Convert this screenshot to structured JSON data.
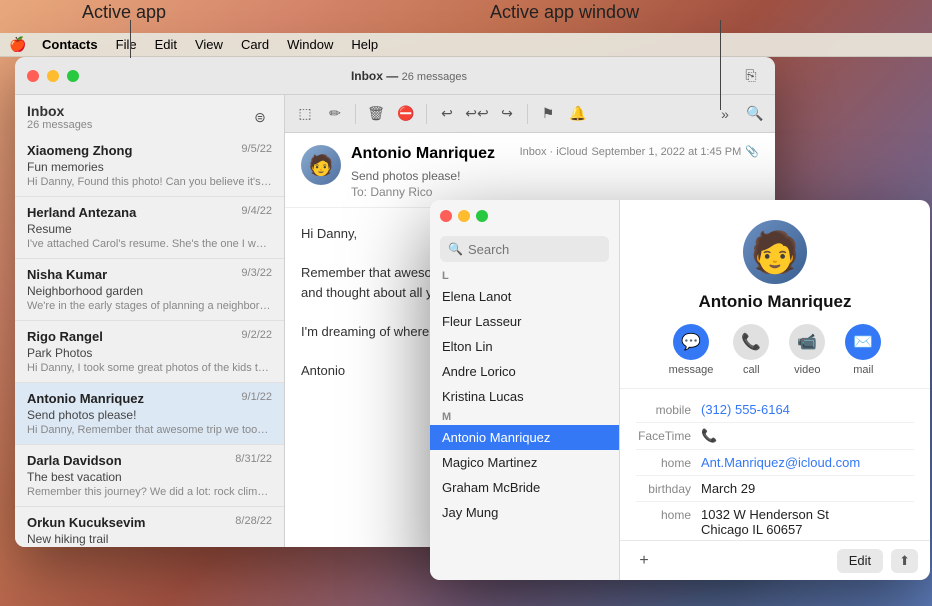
{
  "annotations": {
    "active_app_label": "Active app",
    "active_app_window_label": "Active app window"
  },
  "menubar": {
    "apple_icon": "🍎",
    "items": [
      {
        "label": "Contacts",
        "active": true
      },
      {
        "label": "File"
      },
      {
        "label": "Edit"
      },
      {
        "label": "View"
      },
      {
        "label": "Card"
      },
      {
        "label": "Window"
      },
      {
        "label": "Help"
      }
    ]
  },
  "mail_window": {
    "title": "Inbox",
    "subtitle": "26 messages",
    "messages": [
      {
        "sender": "Xiaomeng Zhong",
        "date": "9/5/22",
        "subject": "Fun memories",
        "preview": "Hi Danny, Found this photo! Can you believe it's been years? Let's start planning our next adventure (or at least...",
        "attachment": true,
        "selected": false
      },
      {
        "sender": "Herland Antezana",
        "date": "9/4/22",
        "subject": "Resume",
        "preview": "I've attached Carol's resume. She's the one I was telling you about. She may not have quite as much experience as you...",
        "attachment": true,
        "selected": false
      },
      {
        "sender": "Nisha Kumar",
        "date": "9/3/22",
        "subject": "Neighborhood garden",
        "preview": "We're in the early stages of planning a neighborhood garden. Each family would be in charge of a plot. Bring yo...",
        "attachment": false,
        "selected": false
      },
      {
        "sender": "Rigo Rangel",
        "date": "9/2/22",
        "subject": "Park Photos",
        "preview": "Hi Danny, I took some great photos of the kids the other day. Check out that smile!",
        "attachment": true,
        "selected": false
      },
      {
        "sender": "Antonio Manriquez",
        "date": "9/1/22",
        "subject": "Send photos please!",
        "preview": "Hi Danny, Remember that awesome trip we took a few years ago? I found this picture, and thought about all your fun r...",
        "attachment": false,
        "selected": true
      },
      {
        "sender": "Darla Davidson",
        "date": "8/31/22",
        "subject": "The best vacation",
        "preview": "Remember this journey? We did a lot: rock climbing, cycling, hiking, and more. This vacation was amazing. An...",
        "attachment": true,
        "selected": false
      },
      {
        "sender": "Orkun Kucuksevim",
        "date": "8/28/22",
        "subject": "New hiking trail",
        "preview": "",
        "attachment": true,
        "selected": false
      }
    ],
    "detail": {
      "sender": "Antonio Manriquez",
      "inbox_tag": "Inbox · iCloud",
      "date": "September 1, 2022 at 1:45 PM",
      "subject": "Send photos please!",
      "to": "To: Danny Rico",
      "body": "Hi Danny,\n\nRemember that awesome trip we took a few years ago? I found this picture, and thought about all your fun road trip games :)\n\nI'm dreaming of where...\n\nAntonio"
    }
  },
  "contacts_window": {
    "search_placeholder": "Search",
    "groups": [
      {
        "label": "L",
        "contacts": [
          {
            "name": "Elena Lanot",
            "selected": false
          },
          {
            "name": "Fleur Lasseur",
            "selected": false
          },
          {
            "name": "Elton Lin",
            "selected": false
          },
          {
            "name": "Andre Lorico",
            "selected": false
          },
          {
            "name": "Kristina Lucas",
            "selected": false
          }
        ]
      },
      {
        "label": "M",
        "contacts": [
          {
            "name": "Antonio Manriquez",
            "selected": true
          },
          {
            "name": "Magico Martinez",
            "selected": false
          },
          {
            "name": "Graham McBride",
            "selected": false
          },
          {
            "name": "Jay Mung",
            "selected": false
          }
        ]
      }
    ],
    "selected_contact": {
      "name": "Antonio Manriquez",
      "avatar_emoji": "🧑",
      "actions": [
        {
          "icon": "💬",
          "label": "message",
          "style": "blue"
        },
        {
          "icon": "📞",
          "label": "call",
          "style": "gray"
        },
        {
          "icon": "📹",
          "label": "video",
          "style": "gray"
        },
        {
          "icon": "✉️",
          "label": "mail",
          "style": "blue"
        }
      ],
      "fields": [
        {
          "label": "mobile",
          "value": "(312) 555-6164",
          "type": "link"
        },
        {
          "label": "FaceTime",
          "value": "📞",
          "type": "icon"
        },
        {
          "label": "home",
          "value": "Ant.Manriquez@icloud.com",
          "type": "link"
        },
        {
          "label": "birthday",
          "value": "March 29",
          "type": "text"
        },
        {
          "label": "home",
          "value": "1032 W Henderson St\nChicago IL 60657",
          "type": "text"
        },
        {
          "label": "note",
          "value": "",
          "type": "text"
        }
      ]
    },
    "buttons": {
      "add": "+",
      "edit": "Edit",
      "share": "⬆"
    }
  }
}
